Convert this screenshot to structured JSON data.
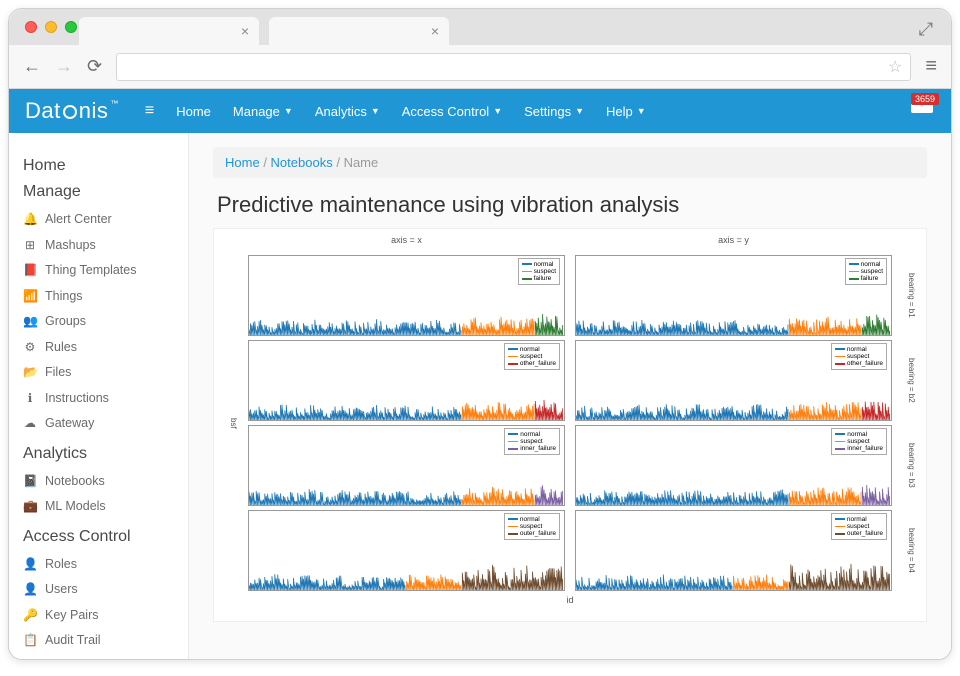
{
  "browser": {
    "tabs": [
      {
        "close": "×"
      },
      {
        "close": "×"
      }
    ],
    "url": ""
  },
  "brand": "Datonis",
  "notif_count": "3659",
  "top_nav": [
    "Home",
    "Manage",
    "Analytics",
    "Access Control",
    "Settings",
    "Help"
  ],
  "sidebar": {
    "sections": [
      {
        "heading": "Home",
        "items": []
      },
      {
        "heading": "Manage",
        "items": [
          {
            "icon": "bell",
            "label": "Alert Center"
          },
          {
            "icon": "dashboard",
            "label": "Mashups"
          },
          {
            "icon": "book",
            "label": "Thing Templates"
          },
          {
            "icon": "signal",
            "label": "Things"
          },
          {
            "icon": "group",
            "label": "Groups"
          },
          {
            "icon": "gears",
            "label": "Rules"
          },
          {
            "icon": "folder",
            "label": "Files"
          },
          {
            "icon": "info",
            "label": "Instructions"
          },
          {
            "icon": "gateway",
            "label": "Gateway"
          }
        ]
      },
      {
        "heading": "Analytics",
        "items": [
          {
            "icon": "notebook",
            "label": "Notebooks"
          },
          {
            "icon": "briefcase",
            "label": "ML Models"
          }
        ]
      },
      {
        "heading": "Access Control",
        "items": [
          {
            "icon": "role",
            "label": "Roles"
          },
          {
            "icon": "user",
            "label": "Users"
          },
          {
            "icon": "key",
            "label": "Key Pairs"
          },
          {
            "icon": "audit",
            "label": "Audit Trail"
          }
        ]
      }
    ]
  },
  "breadcrumb": [
    "Home",
    "Notebooks",
    "Name"
  ],
  "page_title": "Predictive maintenance using vibration analysis",
  "chart_data": {
    "type": "line",
    "xlabel": "id",
    "ylabel": "bsf",
    "xlim": [
      0,
      2200
    ],
    "ylim": [
      0,
      100
    ],
    "xticks": [
      0,
      500,
      1000,
      1500,
      2000
    ],
    "yticks": [
      0,
      20,
      40,
      60,
      80,
      100
    ],
    "col_facets": [
      {
        "name": "axis = x"
      },
      {
        "name": "axis = y"
      }
    ],
    "row_facets": [
      {
        "name": "bearing = b1",
        "series": [
          "normal",
          "suspect",
          "failure"
        ],
        "third_color": "#2e7d32"
      },
      {
        "name": "bearing = b2",
        "series": [
          "normal",
          "suspect",
          "other_failure"
        ],
        "third_color": "#c62828"
      },
      {
        "name": "bearing = b3",
        "series": [
          "normal",
          "suspect",
          "inner_failure"
        ],
        "third_color": "#7b5fa3"
      },
      {
        "name": "bearing = b4",
        "series": [
          "normal",
          "suspect",
          "outer_failure"
        ],
        "third_color": "#6d4c2f"
      }
    ],
    "colors": {
      "normal": "#1f77b4",
      "suspect": "#ff7f0e",
      "failure": "#2e7d32",
      "other_failure": "#c62828",
      "inner_failure": "#7b5fa3",
      "outer_failure": "#6d4c2f"
    },
    "segments_note": "Each panel shows noisy time-series ~amplitude 5–25 bsf. Blue 'normal' roughly id 0–1500, orange 'suspect' roughly 1500–2000, third colored 'failure-type' segment near end ~2000–2200. Row b4 has a wider brown segment from ~1500 and blue extends to ~1100."
  }
}
